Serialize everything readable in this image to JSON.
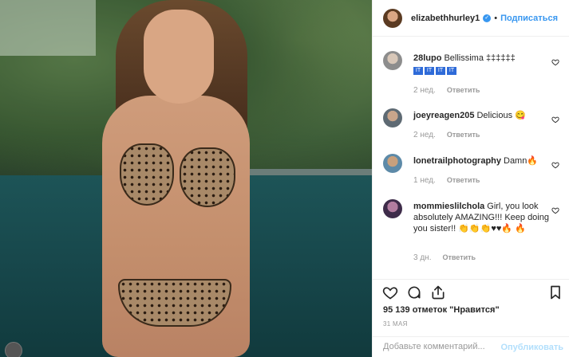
{
  "post": {
    "username": "elizabethhurley1",
    "verified": true,
    "follow_label": "Подписаться",
    "likes_text": "95 139 отметок \"Нравится\"",
    "date": "31 МАЯ",
    "comment_placeholder": "Добавьте комментарий...",
    "publish_label": "Опубликовать"
  },
  "comments": [
    {
      "username": "28lupo",
      "text": "Bellissima ‡‡‡‡‡‡",
      "flags": [
        "IT",
        "IT",
        "IT",
        "IT"
      ],
      "age": "2 нед.",
      "reply_label": "Ответить"
    },
    {
      "username": "joeyreagen205",
      "text": "Delicious 😋",
      "age": "2 нед.",
      "reply_label": "Ответить"
    },
    {
      "username": "lonetrailphotography",
      "text": "Damn🔥",
      "age": "1 нед.",
      "reply_label": "Ответить"
    },
    {
      "username": "mommieslilchola",
      "text": "Girl, you look absolutely AMAZING!!! Keep doing you sister!! 👏👏👏♥♥🔥 🔥",
      "age": "3 дн.",
      "reply_label": "Ответить"
    }
  ],
  "icons": {
    "like": "heart-icon",
    "comment": "comment-icon",
    "share": "share-icon",
    "save": "bookmark-icon"
  },
  "colors": {
    "accent": "#3897f0",
    "muted": "#999999",
    "publish_disabled": "#b2dffc"
  }
}
